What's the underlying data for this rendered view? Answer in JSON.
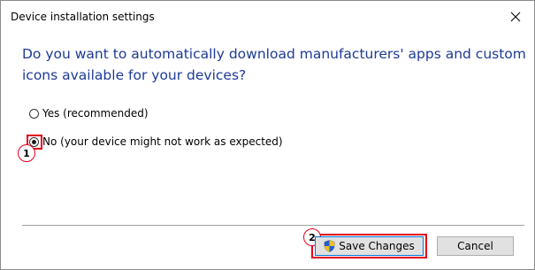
{
  "window": {
    "title": "Device installation settings"
  },
  "dialog": {
    "question": "Do you want to automatically download manufacturers' apps and custom icons available for your devices?",
    "options": [
      {
        "label": "Yes (recommended)",
        "selected": false
      },
      {
        "label": "No (your device might not work as expected)",
        "selected": true
      }
    ]
  },
  "annotations": {
    "step1": "1",
    "step2": "2",
    "highlight_color": "#e3001b"
  },
  "buttons": {
    "save_label": "Save Changes",
    "save_icon": "uac-shield-icon",
    "cancel_label": "Cancel"
  },
  "colors": {
    "question_text": "#1e3a96"
  }
}
